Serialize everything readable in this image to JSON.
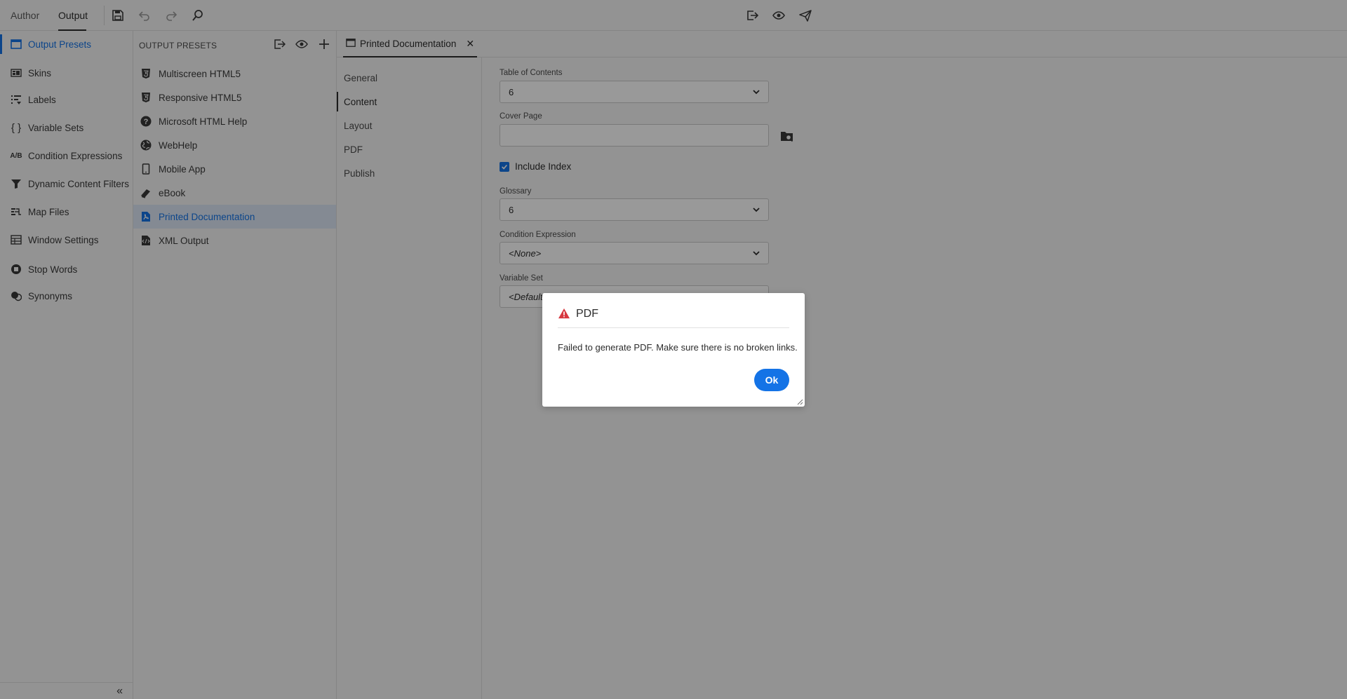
{
  "topbar": {
    "tabs": [
      {
        "label": "Author"
      },
      {
        "label": "Output"
      }
    ]
  },
  "leftnav": {
    "items": [
      {
        "label": "Output Presets",
        "icon": "output-presets-icon"
      },
      {
        "label": "Skins",
        "icon": "skins-icon"
      },
      {
        "label": "Labels",
        "icon": "labels-icon"
      },
      {
        "label": "Variable Sets",
        "icon": "braces-icon"
      },
      {
        "label": "Condition Expressions",
        "icon": "ab-icon",
        "icon_text": "A/B"
      },
      {
        "label": "Dynamic Content Filters",
        "icon": "filter-icon"
      },
      {
        "label": "Map Files",
        "icon": "map-files-icon"
      },
      {
        "label": "Window Settings",
        "icon": "window-settings-icon"
      },
      {
        "label": "Stop Words",
        "icon": "stop-words-icon"
      },
      {
        "label": "Synonyms",
        "icon": "synonyms-icon"
      }
    ]
  },
  "presets": {
    "title": "OUTPUT PRESETS",
    "items": [
      {
        "label": "Multiscreen HTML5",
        "icon": "html5-icon"
      },
      {
        "label": "Responsive HTML5",
        "icon": "html5-icon"
      },
      {
        "label": "Microsoft HTML Help",
        "icon": "help-icon"
      },
      {
        "label": "WebHelp",
        "icon": "globe-icon"
      },
      {
        "label": "Mobile App",
        "icon": "mobile-icon"
      },
      {
        "label": "eBook",
        "icon": "ebook-icon"
      },
      {
        "label": "Printed Documentation",
        "icon": "pdf-file-icon"
      },
      {
        "label": "XML Output",
        "icon": "xml-file-icon"
      }
    ]
  },
  "editor": {
    "tab_label": "Printed Documentation",
    "subnav": [
      "General",
      "Content",
      "Layout",
      "PDF",
      "Publish"
    ],
    "form": {
      "toc_label": "Table of Contents",
      "toc_value": "6",
      "cover_label": "Cover Page",
      "include_index_label": "Include Index",
      "glossary_label": "Glossary",
      "glossary_value": "6",
      "condition_label": "Condition Expression",
      "condition_value": "<None>",
      "variable_label": "Variable Set",
      "variable_value": "<Default>"
    }
  },
  "dialog": {
    "title": "PDF",
    "message": "Failed to generate PDF. Make sure there is no broken links.",
    "ok_label": "Ok"
  },
  "colors": {
    "accent": "#1473e6",
    "warning": "#d7373f"
  }
}
